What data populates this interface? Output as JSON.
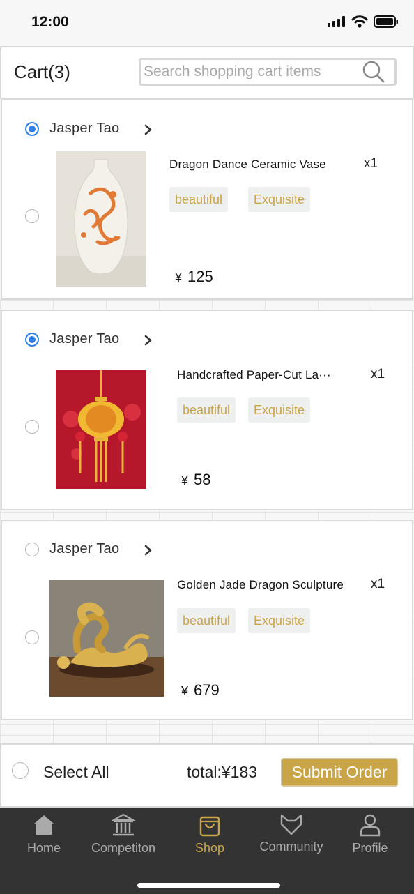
{
  "status": {
    "time": "12:00"
  },
  "header": {
    "title": "Cart(3)",
    "search_placeholder": "Search shopping cart items"
  },
  "items": [
    {
      "seller": "Jasper Tao",
      "seller_checked": true,
      "item_checked": false,
      "name": "Dragon Dance Ceramic Vase",
      "qty": "x1",
      "tags": [
        "beautiful",
        "Exquisite"
      ],
      "currency": "¥",
      "price": "125"
    },
    {
      "seller": "Jasper Tao",
      "seller_checked": true,
      "item_checked": false,
      "name": "Handcrafted Paper-Cut La···",
      "qty": "x1",
      "tags": [
        "beautiful",
        "Exquisite"
      ],
      "currency": "¥",
      "price": "58"
    },
    {
      "seller": "Jasper Tao",
      "seller_checked": false,
      "item_checked": false,
      "name": "Golden Jade Dragon Sculpture",
      "qty": "x1",
      "tags": [
        "beautiful",
        "Exquisite"
      ],
      "currency": "¥",
      "price": "679"
    }
  ],
  "footer": {
    "select_all": "Select All",
    "total": "total:¥183",
    "submit": "Submit Order"
  },
  "tabbar": [
    {
      "label": "Home",
      "icon": "home-icon",
      "active": false
    },
    {
      "label": "Competiton",
      "icon": "museum-icon",
      "active": false
    },
    {
      "label": "Shop",
      "icon": "shopping-bag-icon",
      "active": true
    },
    {
      "label": "Community",
      "icon": "fox-icon",
      "active": false
    },
    {
      "label": "Profile",
      "icon": "person-icon",
      "active": false
    }
  ],
  "colors": {
    "accent_gold": "#c9a548",
    "radio_blue": "#2f7fe8",
    "tabbar_bg": "#333333"
  }
}
